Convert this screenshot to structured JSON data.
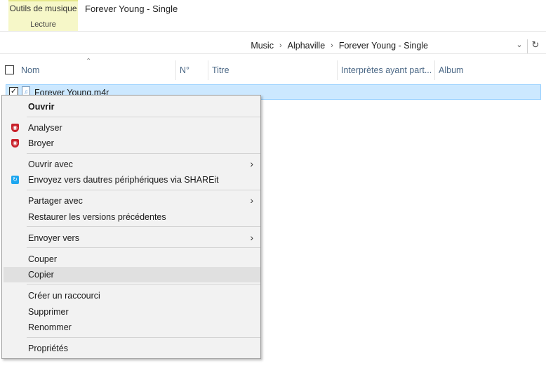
{
  "ribbon": {
    "context_tab_title": "Outils de musique",
    "context_tab_sub": "Lecture",
    "window_title": "Forever Young - Single"
  },
  "address": {
    "crumbs": [
      "Music",
      "Alphaville",
      "Forever Young - Single"
    ],
    "separator": "›",
    "dropdown_icon": "chevron-down-icon",
    "refresh_icon": "refresh-icon"
  },
  "columns": {
    "name": "Nom",
    "number": "N°",
    "title": "Titre",
    "artists": "Interprètes ayant part...",
    "album": "Album"
  },
  "file": {
    "name": "Forever Young.m4r",
    "checked": true
  },
  "menu": {
    "open": "Ouvrir",
    "analyze": "Analyser",
    "shred": "Broyer",
    "open_with": "Ouvrir avec",
    "shareit": "Envoyez vers dautres périphériques via SHAREit",
    "share_with": "Partager avec",
    "restore": "Restaurer les versions précédentes",
    "send_to": "Envoyer vers",
    "cut": "Couper",
    "copy": "Copier",
    "shortcut": "Créer un raccourci",
    "delete": "Supprimer",
    "rename": "Renommer",
    "properties": "Propriétés"
  },
  "colors": {
    "selection_bg": "#cce8ff",
    "context_tab_bg": "#f6f7c8",
    "header_text": "#4a6785",
    "menu_bg": "#f2f2f2"
  }
}
